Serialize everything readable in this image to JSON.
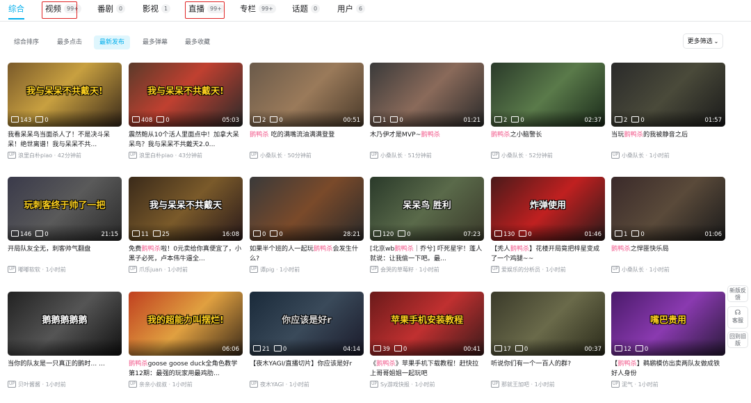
{
  "tabs": [
    {
      "label": "综合",
      "count": ""
    },
    {
      "label": "视频",
      "count": "99+"
    },
    {
      "label": "番剧",
      "count": "0"
    },
    {
      "label": "影视",
      "count": "1"
    },
    {
      "label": "直播",
      "count": "99+"
    },
    {
      "label": "专栏",
      "count": "99+"
    },
    {
      "label": "话题",
      "count": "0"
    },
    {
      "label": "用户",
      "count": "6"
    }
  ],
  "sort_options": [
    "综合排序",
    "最多点击",
    "最新发布",
    "最多弹幕",
    "最多收藏"
  ],
  "more_filter": "更多筛选",
  "videos": [
    {
      "plays": "143",
      "danmaku": "0",
      "duration": "",
      "title_pre": "我看呆呆鸟当面杀人了！不是决斗呆呆！绝世离谱！我与呆呆不共...",
      "title_hl": "",
      "title_post": "",
      "uploader": "浪里白朴piao",
      "time": "42分钟前",
      "overlay": "我与呆呆不共戴天!"
    },
    {
      "plays": "408",
      "danmaku": "0",
      "duration": "05:03",
      "title_pre": "震然鲍从10个活人里面点中！加拿大呆呆鸟？我与呆呆不共戴天2.0...",
      "title_hl": "",
      "title_post": "",
      "uploader": "浪里白朴piao",
      "time": "43分钟前",
      "overlay": "我与呆呆不共戴天!"
    },
    {
      "plays": "2",
      "danmaku": "0",
      "duration": "00:51",
      "title_pre": "",
      "title_hl": "鹅鸭杀",
      "title_post": " 吃的满嘴流油满满登登",
      "uploader": "小桑队长",
      "time": "50分钟前",
      "overlay": ""
    },
    {
      "plays": "1",
      "danmaku": "0",
      "duration": "01:21",
      "title_pre": "木乃伊才是MVP~",
      "title_hl": "鹅鸭杀",
      "title_post": "",
      "uploader": "小桑队长",
      "time": "51分钟前",
      "overlay": ""
    },
    {
      "plays": "2",
      "danmaku": "0",
      "duration": "02:37",
      "title_pre": "",
      "title_hl": "鹅鸭杀",
      "title_post": "之小脑警长",
      "uploader": "小桑队长",
      "time": "52分钟前",
      "overlay": ""
    },
    {
      "plays": "2",
      "danmaku": "0",
      "duration": "01:57",
      "title_pre": "当玩",
      "title_hl": "鹅鸭杀",
      "title_post": "的我被静音之后",
      "uploader": "小桑队长",
      "time": "1小时前",
      "overlay": ""
    },
    {
      "plays": "146",
      "danmaku": "0",
      "duration": "21:15",
      "title_pre": "开局队友全无，刺客帅气翻盘",
      "title_hl": "",
      "title_post": "",
      "uploader": "嘟嘟软软",
      "time": "1小时前",
      "overlay": "玩刺客终于帅了一把"
    },
    {
      "plays": "11",
      "danmaku": "25",
      "duration": "16:08",
      "title_pre": "免费",
      "title_hl": "鹅鸭杀",
      "title_post": "啦！0元卖给你真便宜了，小黑子必死，卢本伟牛逼全...",
      "uploader": "爪乐juan",
      "time": "1小时前",
      "overlay": "我与呆呆不共戴天"
    },
    {
      "plays": "0",
      "danmaku": "0",
      "duration": "28:21",
      "title_pre": "如果半个班的人一起玩",
      "title_hl": "鹅鸭杀",
      "title_post": "会发生什么?",
      "uploader": "谭pig",
      "time": "1小时前",
      "overlay": ""
    },
    {
      "plays": "120",
      "danmaku": "0",
      "duration": "07:23",
      "title_pre": "[北京wb",
      "title_hl": "鹅鸭杀",
      "title_post": "｜乔兮] 吓死星宇！蓬人就说：让我偷一下吧。最...",
      "uploader": "会哭的草莓籽",
      "time": "1小时前",
      "overlay": "呆呆鸟 胜利"
    },
    {
      "plays": "130",
      "danmaku": "0",
      "duration": "01:46",
      "title_pre": "【秃人",
      "title_hl": "鹅鸭杀",
      "title_post": "】花楼开局竟把梓星变成了一个鸡腿~~",
      "uploader": "爱娱乐的分析员",
      "time": "1小时前",
      "overlay": "炸弹使用"
    },
    {
      "plays": "1",
      "danmaku": "0",
      "duration": "01:06",
      "title_pre": "",
      "title_hl": "鹅鸭杀",
      "title_post": "之悍匪快乐局",
      "uploader": "小桑队长",
      "time": "1小时前",
      "overlay": ""
    },
    {
      "plays": "",
      "danmaku": "",
      "duration": "",
      "title_pre": "当你的队友是一只真正的鹅时... ...",
      "title_hl": "",
      "title_post": "",
      "uploader": "贝叶酱酱",
      "time": "1小时前",
      "overlay": "鹅鹅鹅鹅鹅"
    },
    {
      "plays": "",
      "danmaku": "",
      "duration": "06:06",
      "title_pre": "",
      "title_hl": "鹅鸭杀",
      "title_post": "goose goose duck全角色教学第12期：最强的玩家用最鸡肋...",
      "uploader": "亲亲小叔叔",
      "time": "1小时前",
      "overlay": "我的超能力叫摆烂!"
    },
    {
      "plays": "21",
      "danmaku": "0",
      "duration": "04:14",
      "title_pre": "【夜木YAGI/直播切片】你应该是好r",
      "title_hl": "",
      "title_post": "",
      "uploader": "夜木YAGI",
      "time": "1小时前",
      "overlay": "你应该是好r"
    },
    {
      "plays": "39",
      "danmaku": "0",
      "duration": "00:41",
      "title_pre": "《",
      "title_hl": "鹅鸭杀",
      "title_post": "》苹果手机下载教程！赶快拉上哥哥姐姐一起玩吧",
      "uploader": "Sy游戏快报",
      "time": "1小时前",
      "overlay": "苹果手机安装教程"
    },
    {
      "plays": "17",
      "danmaku": "0",
      "duration": "00:37",
      "title_pre": "听说你们有一个一百人的群?",
      "title_hl": "",
      "title_post": "",
      "uploader": "那就王加吧",
      "time": "1小时前",
      "overlay": ""
    },
    {
      "plays": "12",
      "danmaku": "0",
      "duration": "",
      "title_pre": "【",
      "title_hl": "鹅鸭杀",
      "title_post": "】鹈鹕模仿出卖两队友做成铁好人身份",
      "uploader": "泥气",
      "time": "1小时前",
      "overlay": "嘴巴贵用"
    }
  ],
  "side_buttons": [
    "新版反馈",
    "客服",
    "回到旧版"
  ],
  "colors": {
    "accent": "#00aeec",
    "highlight": "#f25d8e",
    "annotation": "#e02424"
  }
}
